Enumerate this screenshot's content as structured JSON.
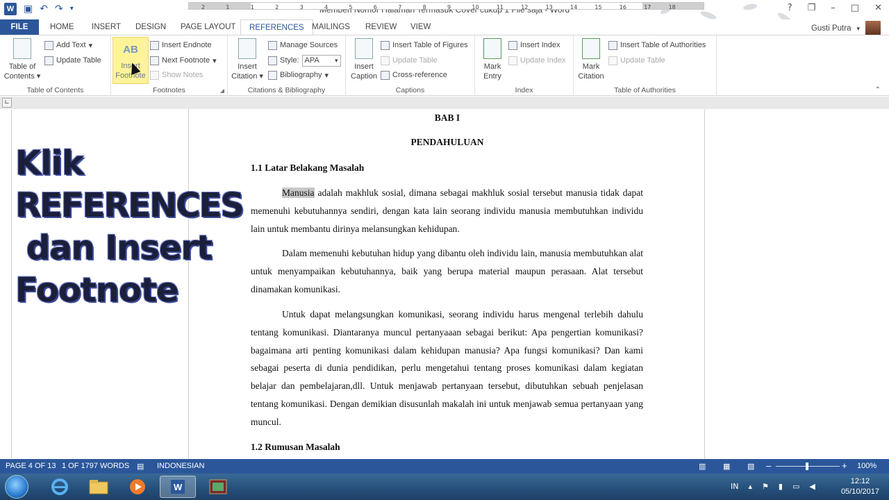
{
  "window": {
    "title": "Memberi Nomor Halaman Termasuk Cover cukup 1 File saja - Word",
    "controls": [
      "?",
      "❐",
      "–",
      "□",
      "✕"
    ]
  },
  "tabs": [
    "FILE",
    "HOME",
    "INSERT",
    "DESIGN",
    "PAGE LAYOUT",
    "REFERENCES",
    "MAILINGS",
    "REVIEW",
    "VIEW"
  ],
  "active_tab": "REFERENCES",
  "user": {
    "name": "Gusti Putra"
  },
  "ribbon": {
    "toc": {
      "table_of_contents": "Table of Contents",
      "add_text": "Add Text",
      "update_table": "Update Table",
      "group_label": "Table of Contents"
    },
    "footnotes": {
      "insert_footnote": "Insert Footnote",
      "ab_icon": "AB",
      "insert_endnote": "Insert Endnote",
      "next_footnote": "Next Footnote",
      "show_notes": "Show Notes",
      "group_label": "Footnotes"
    },
    "citations": {
      "insert_citation": "Insert Citation",
      "manage_sources": "Manage Sources",
      "style_label": "Style:",
      "style_value": "APA",
      "bibliography": "Bibliography",
      "group_label": "Citations & Bibliography"
    },
    "captions": {
      "insert_caption": "Insert Caption",
      "insert_table_of_figures": "Insert Table of Figures",
      "update_table": "Update Table",
      "cross_reference": "Cross-reference",
      "group_label": "Captions"
    },
    "index": {
      "mark_entry": "Mark Entry",
      "insert_index": "Insert Index",
      "update_index": "Update Index",
      "group_label": "Index"
    },
    "authorities": {
      "mark_citation": "Mark Citation",
      "insert_table_of_authorities": "Insert Table of Authorities",
      "update_table": "Update Table",
      "group_label": "Table of Authorities"
    }
  },
  "ruler": {
    "numbers": [
      "2",
      "1",
      "1",
      "2",
      "3",
      "4",
      "5",
      "6",
      "7",
      "8",
      "9",
      "10",
      "11",
      "12",
      "13",
      "14",
      "15",
      "16",
      "17",
      "18"
    ]
  },
  "document": {
    "chapter": "BAB I",
    "chapter_title": "PENDAHULUAN",
    "heading1": "1.1 Latar Belakang Masalah",
    "p1_highlight": "Manusia",
    "p1_rest": " adalah makhluk sosial, dimana sebagai makhluk sosial tersebut manusia tidak dapat memenuhi kebutuhannya sendiri, dengan kata lain seorang individu manusia membutuhkan individu lain untuk membantu dirinya melansungkan kehidupan.",
    "p2": "Dalam memenuhi kebutuhan hidup yang dibantu oleh individu lain, manusia membutuhkan alat untuk menyampaikan kebutuhannya, baik yang berupa material maupun perasaan. Alat tersebut dinamakan komunikasi.",
    "p3": "Untuk dapat melangsungkan komunikasi, seorang individu harus mengenal terlebih dahulu tentang komunikasi. Diantaranya muncul pertanyaaan sebagai berikut: Apa pengertian komunikasi? bagaimana arti penting komunikasi dalam kehidupan manusia? Apa fungsi komunikasi? Dan kami sebagai peserta di dunia pendidikan, perlu mengetahui tentang proses komunikasi dalam kegiatan belajar dan pembelajaran,dll. Untuk menjawab pertanyaan tersebut, dibutuhkan sebuah penjelasan tentang komunikasi. Dengan demikian disusunlah makalah ini untuk menjawab semua pertanyaan yang muncul.",
    "heading2": "1.2 Rumusan Masalah"
  },
  "overlay_caption": [
    "Klik",
    "REFERENCES",
    " dan Insert",
    "Footnote"
  ],
  "status": {
    "page": "PAGE 4 OF 13",
    "words": "1 OF 1797 WORDS",
    "language": "INDONESIAN",
    "zoom": "100%",
    "zoom_minus": "–",
    "zoom_plus": "+"
  },
  "taskbar": {
    "lang": "IN",
    "time": "12:12",
    "date": "05/10/2017"
  }
}
